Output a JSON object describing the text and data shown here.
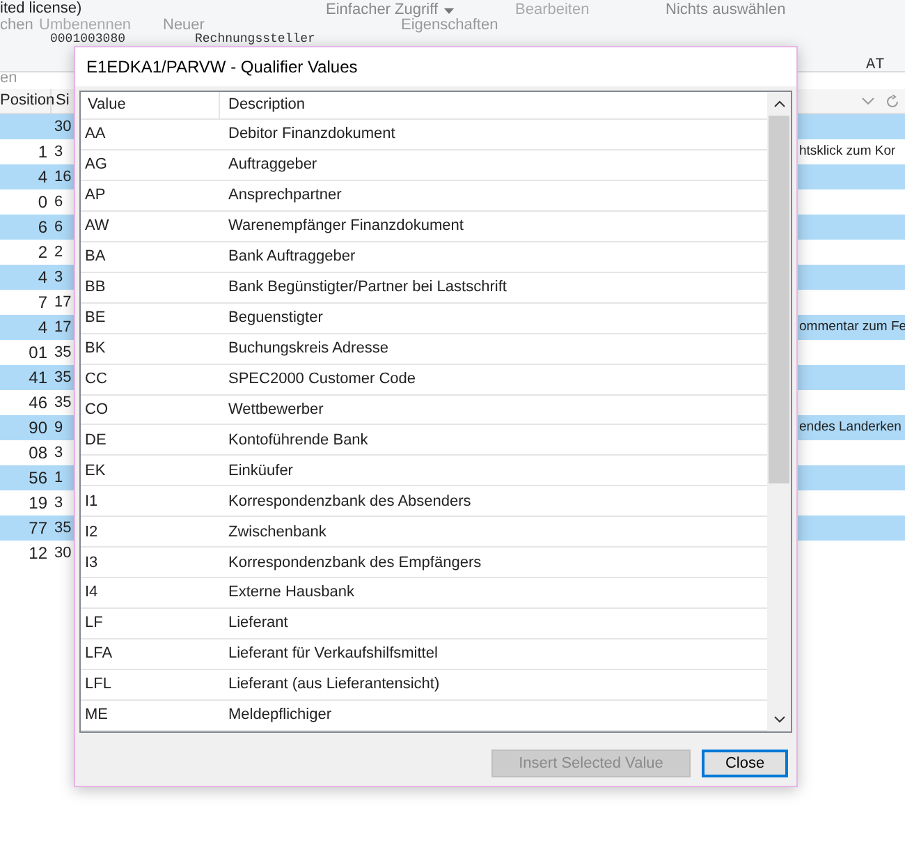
{
  "ribbon": {
    "row_1": [
      "ited license)",
      "Einfacher Zugriff",
      "Bearbeiten",
      "Nichts auswählen"
    ],
    "row_2": [
      "chen",
      "Umbenennen",
      "Neuer",
      "Eigenschaften"
    ],
    "record": [
      "0001003080",
      "Rechnungssteller",
      "AT"
    ],
    "section": "en"
  },
  "background_table": {
    "columns": [
      "Position",
      "Si"
    ],
    "rows": [
      {
        "cells": [
          "",
          "30"
        ],
        "highlighted": true,
        "note": ""
      },
      {
        "cells": [
          "1",
          "3"
        ],
        "highlighted": false,
        "note": "htsklick zum Kor"
      },
      {
        "cells": [
          "4",
          "16"
        ],
        "highlighted": true,
        "note": ""
      },
      {
        "cells": [
          "0",
          "6"
        ],
        "highlighted": false,
        "note": ""
      },
      {
        "cells": [
          "6",
          "6"
        ],
        "highlighted": true,
        "note": ""
      },
      {
        "cells": [
          "2",
          "2"
        ],
        "highlighted": false,
        "note": ""
      },
      {
        "cells": [
          "4",
          "3"
        ],
        "highlighted": true,
        "note": ""
      },
      {
        "cells": [
          "7",
          "17"
        ],
        "highlighted": false,
        "note": ""
      },
      {
        "cells": [
          "4",
          "17"
        ],
        "highlighted": true,
        "note": "ommentar zum Fe"
      },
      {
        "cells": [
          "01",
          "35"
        ],
        "highlighted": false,
        "note": ""
      },
      {
        "cells": [
          "41",
          "35"
        ],
        "highlighted": true,
        "note": ""
      },
      {
        "cells": [
          "46",
          "35"
        ],
        "highlighted": false,
        "note": ""
      },
      {
        "cells": [
          "90",
          "9"
        ],
        "highlighted": true,
        "note": "endes Landerken"
      },
      {
        "cells": [
          "08",
          "3"
        ],
        "highlighted": false,
        "note": ""
      },
      {
        "cells": [
          "56",
          "1"
        ],
        "highlighted": true,
        "note": ""
      },
      {
        "cells": [
          "19",
          "3"
        ],
        "highlighted": false,
        "note": ""
      },
      {
        "cells": [
          "77",
          "35"
        ],
        "highlighted": true,
        "note": ""
      },
      {
        "cells": [
          "12",
          "30"
        ],
        "highlighted": false,
        "note": ""
      }
    ]
  },
  "dialog": {
    "title": "E1EDKA1/PARVW - Qualifier Values",
    "columns": [
      "Value",
      "Description"
    ],
    "rows": [
      [
        "AA",
        "Debitor Finanzdokument"
      ],
      [
        "AG",
        "Auftraggeber"
      ],
      [
        "AP",
        "Ansprechpartner"
      ],
      [
        "AW",
        "Warenempfänger Finanzdokument"
      ],
      [
        "BA",
        "Bank Auftraggeber"
      ],
      [
        "BB",
        "Bank Begünstigter/Partner bei Lastschrift"
      ],
      [
        "BE",
        "Beguenstigter"
      ],
      [
        "BK",
        "Buchungskreis Adresse"
      ],
      [
        "CC",
        "SPEC2000 Customer Code"
      ],
      [
        "CO",
        "Wettbewerber"
      ],
      [
        "DE",
        "Kontoführende Bank"
      ],
      [
        "EK",
        "Einküufer"
      ],
      [
        "I1",
        "Korrespondenzbank des Absenders"
      ],
      [
        "I2",
        "Zwischenbank"
      ],
      [
        "I3",
        "Korrespondenzbank des Empfängers"
      ],
      [
        "I4",
        "Externe Hausbank"
      ],
      [
        "LF",
        "Lieferant"
      ],
      [
        "LFA",
        "Lieferant für Verkaufshilfsmittel"
      ],
      [
        "LFL",
        "Lieferant (aus Lieferantensicht)"
      ],
      [
        "ME",
        "Meldepflichiger"
      ]
    ],
    "buttons": [
      {
        "label": "Insert Selected Value",
        "disabled": true
      },
      {
        "label": "Close",
        "disabled": false
      }
    ]
  }
}
